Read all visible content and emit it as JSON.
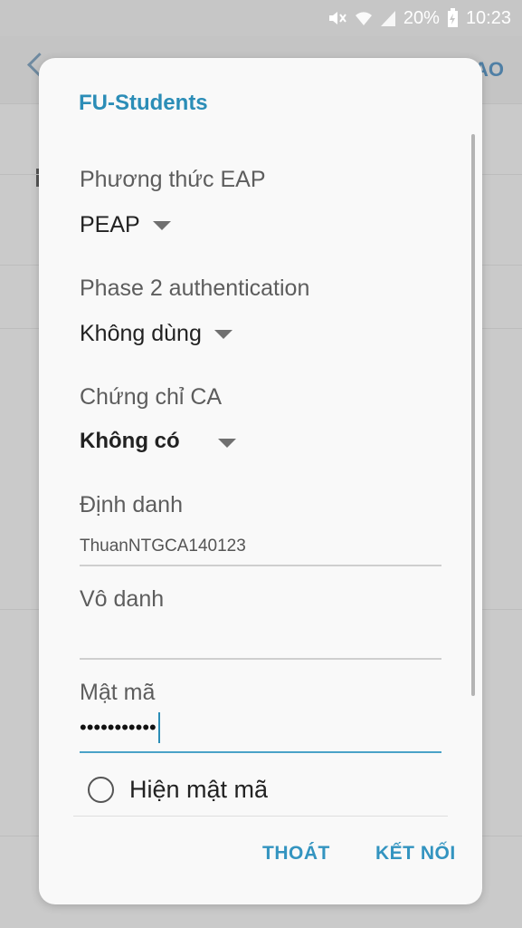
{
  "status_bar": {
    "battery_percent": "20%",
    "time": "10:23",
    "icons": [
      "mute-icon",
      "wifi-icon",
      "signal-icon",
      "battery-charging-icon"
    ]
  },
  "background": {
    "action_partial": "AO"
  },
  "dialog": {
    "title": "FU-Students",
    "eap_method": {
      "label": "Phương thức EAP",
      "value": "PEAP"
    },
    "phase2": {
      "label": "Phase 2 authentication",
      "value": "Không dùng"
    },
    "ca_cert": {
      "label": "Chứng chỉ CA",
      "value": "Không có"
    },
    "identity": {
      "label": "Định danh",
      "value": "ThuanNTGCA140123"
    },
    "anonymous": {
      "label": "Vô danh",
      "value": ""
    },
    "password": {
      "label": "Mật mã",
      "value": "•••••••••••"
    },
    "show_password": {
      "label": "Hiện mật mã",
      "checked": false
    },
    "buttons": {
      "cancel": "THOÁT",
      "connect": "KẾT NỐI"
    }
  },
  "colors": {
    "accent": "#2b8db7",
    "scrim": "#c9c9c9",
    "dialog_bg": "#f9f9f9"
  }
}
